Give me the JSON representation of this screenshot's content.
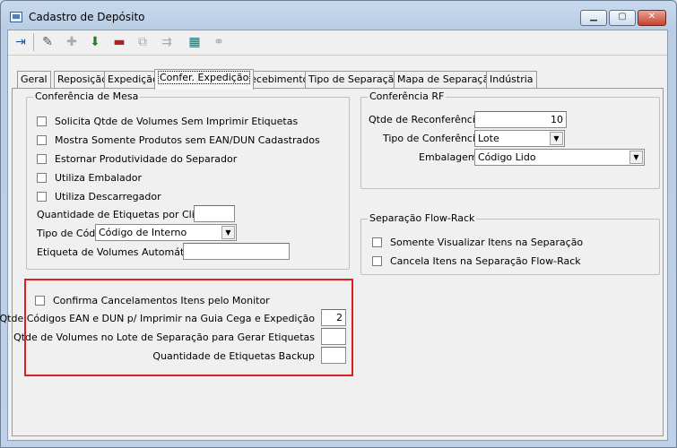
{
  "window": {
    "title": "Cadastro de Depósito"
  },
  "tabs": [
    {
      "label": "Geral"
    },
    {
      "label": "Reposição"
    },
    {
      "label": "Expedição"
    },
    {
      "label": "Confer. Expedição"
    },
    {
      "label": "Recebimento"
    },
    {
      "label": "Tipo de Separação"
    },
    {
      "label": "Mapa de Separação"
    },
    {
      "label": "Indústria"
    }
  ],
  "conferencia_mesa": {
    "title": "Conferência de Mesa",
    "checkboxes": [
      {
        "label": "Solicita Qtde de Volumes Sem Imprimir Etiquetas",
        "checked": false
      },
      {
        "label": "Mostra Somente Produtos sem EAN/DUN Cadastrados",
        "checked": false
      },
      {
        "label": "Estornar Produtividade do Separador",
        "checked": false
      },
      {
        "label": "Utiliza Embalador",
        "checked": false
      },
      {
        "label": "Utiliza Descarregador",
        "checked": false
      }
    ],
    "qtd_etiquetas_label": "Quantidade de Etiquetas por Cliente",
    "qtd_etiquetas_value": "",
    "tipo_codigo_label": "Tipo de Código",
    "tipo_codigo_value": "Código de Interno",
    "etiqueta_volumes_label": "Etiqueta de Volumes Automáticos",
    "etiqueta_volumes_value": ""
  },
  "conferencia_rf": {
    "title": "Conferência RF",
    "qtde_reconferencia_label": "Qtde de Reconferência",
    "qtde_reconferencia_value": "10",
    "tipo_conferencia_label": "Tipo de Conferência",
    "tipo_conferencia_value": "Lote",
    "embalagem_label": "Embalagem",
    "embalagem_value": "Código Lido"
  },
  "flow_rack": {
    "title": "Separação Flow-Rack",
    "checkboxes": [
      {
        "label": "Somente Visualizar Itens na Separação",
        "checked": false
      },
      {
        "label": "Cancela Itens na Separação Flow-Rack",
        "checked": false
      }
    ]
  },
  "extra": {
    "confirma_label": "Confirma Cancelamentos Itens pelo Monitor",
    "qtde_codigos_label": "Qtde Códigos EAN e DUN p/ Imprimir na Guia Cega e Expedição",
    "qtde_codigos_value": "2",
    "qtde_volumes_label": "Qtde de Volumes no Lote de Separação para Gerar Etiquetas",
    "qtde_volumes_value": "",
    "qtd_backup_label": "Quantidade de Etiquetas Backup",
    "qtd_backup_value": ""
  },
  "highlight_color": "#e02020"
}
